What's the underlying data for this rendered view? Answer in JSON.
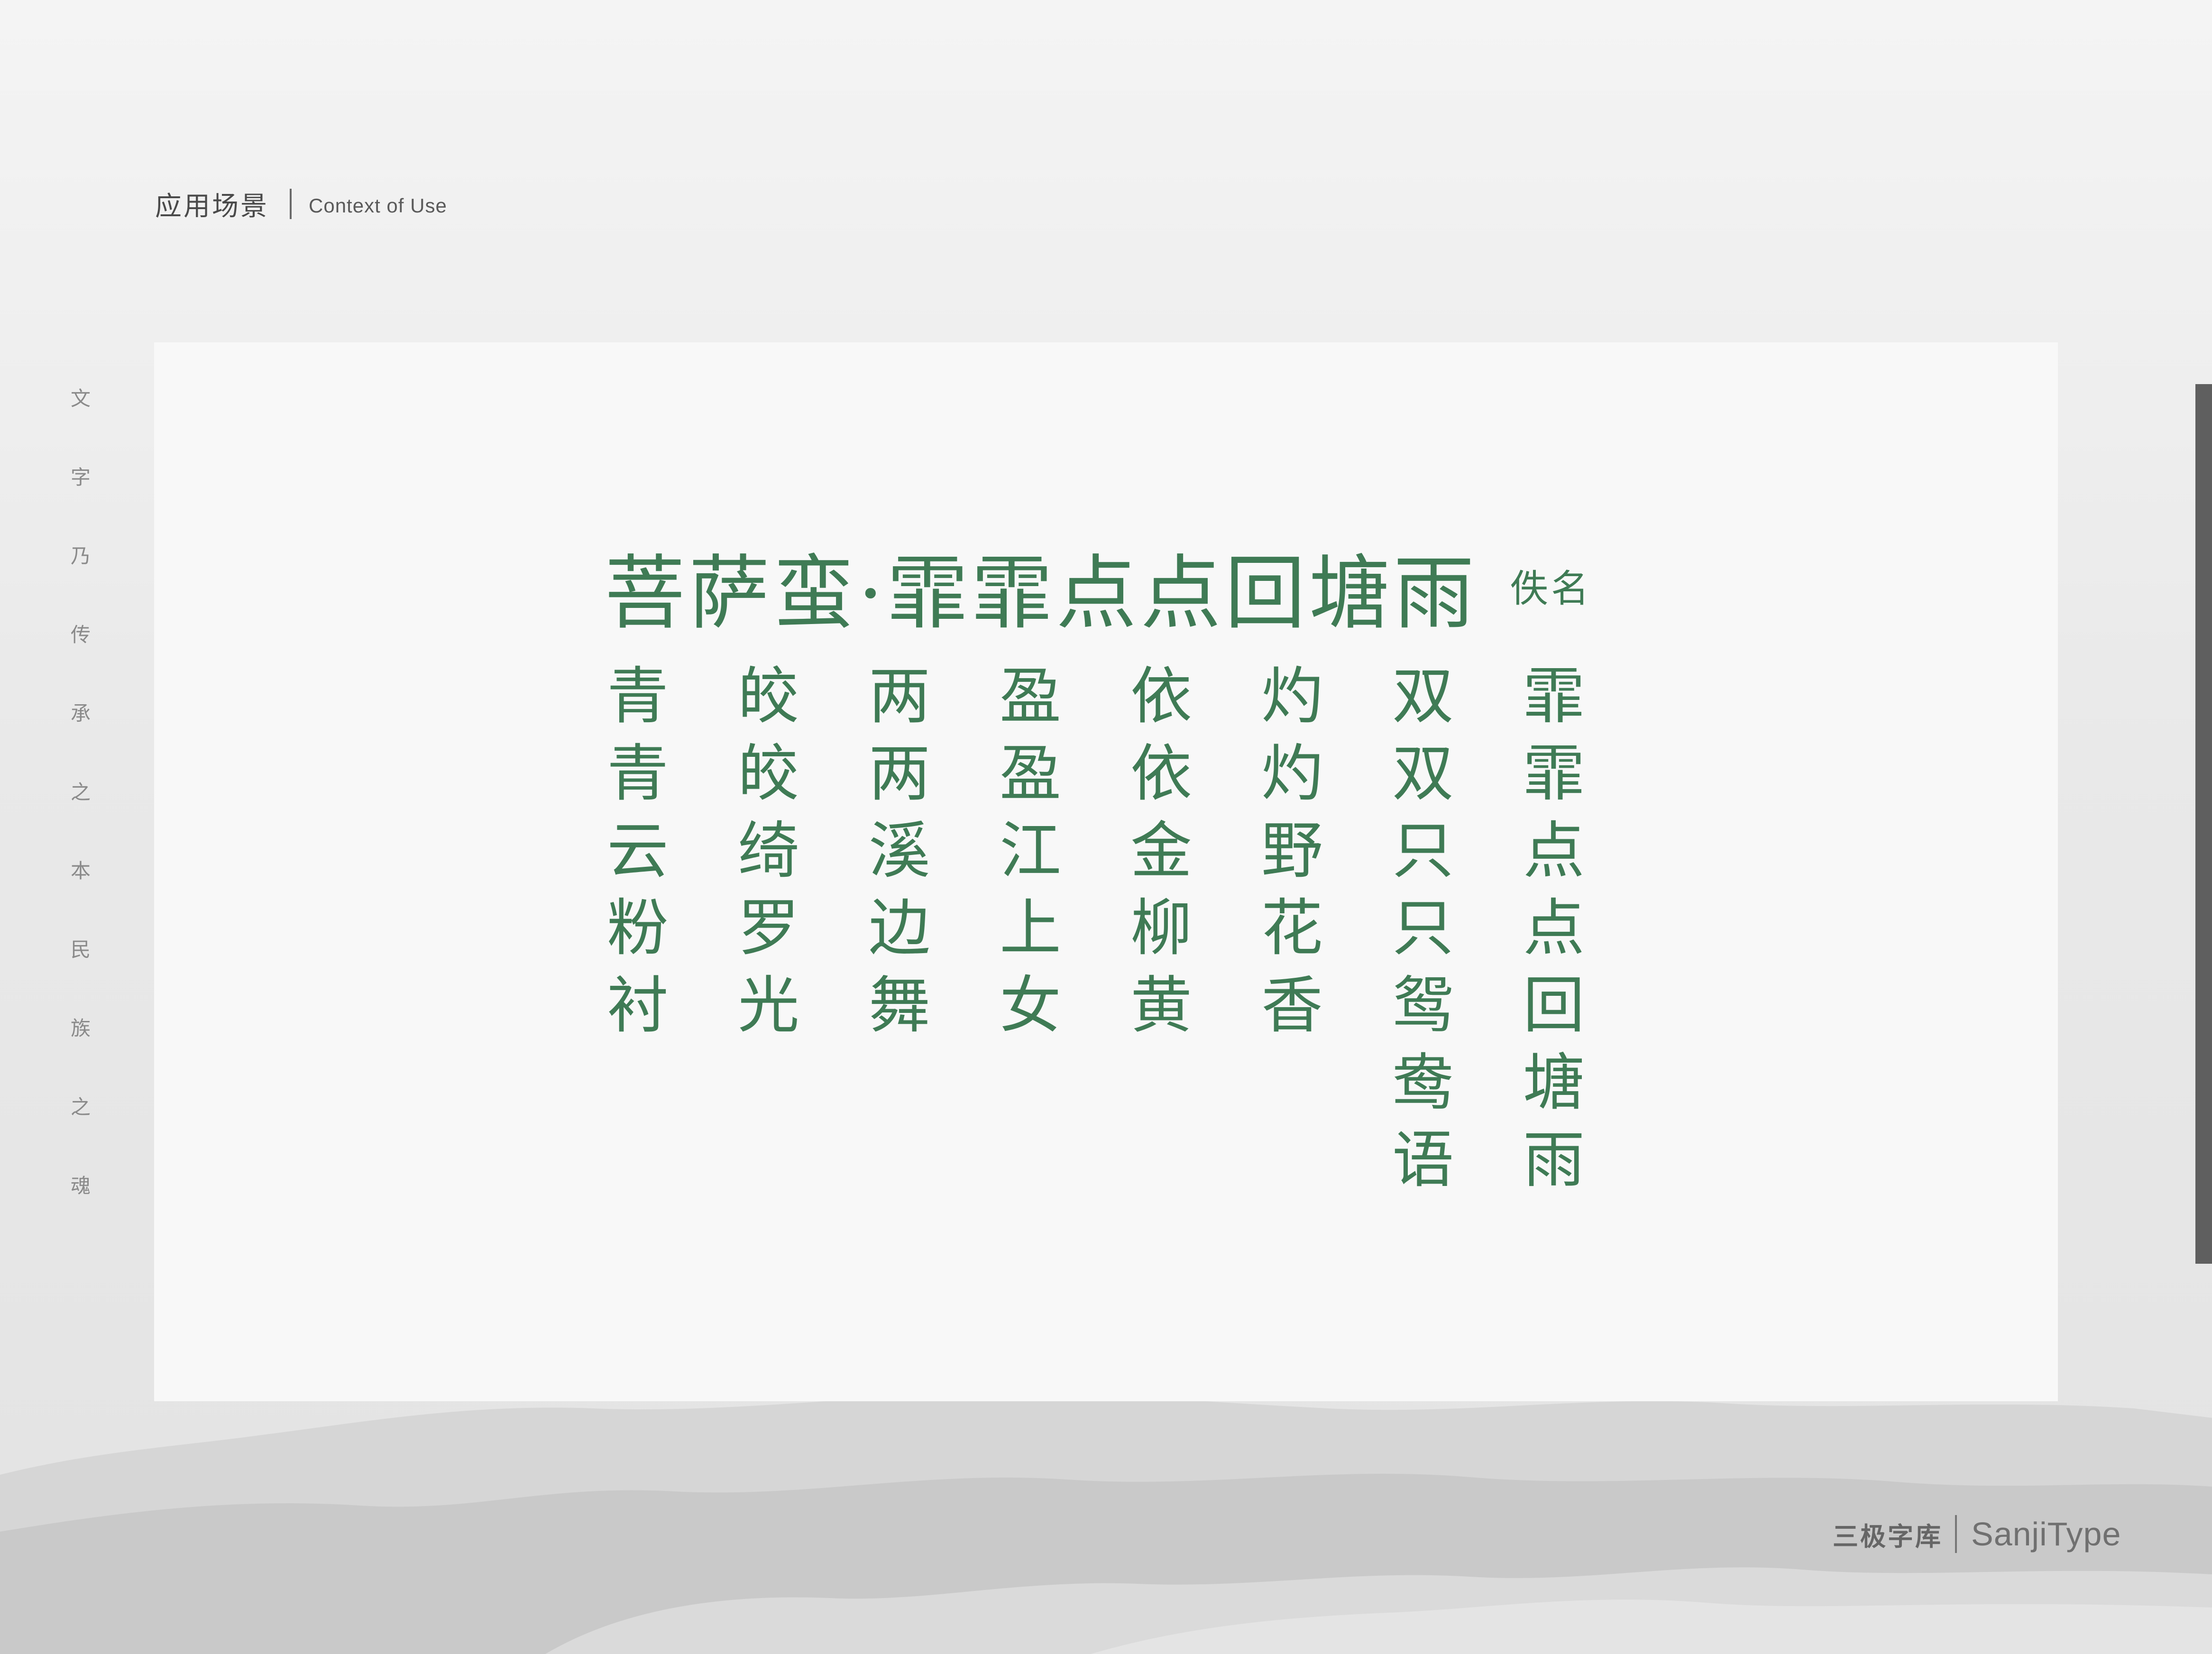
{
  "header": {
    "title_cn": "应用场景",
    "title_en": "Context of Use"
  },
  "motto": [
    "文",
    "字",
    "乃",
    "传",
    "承",
    "之",
    "本",
    "民",
    "族",
    "之",
    "魂"
  ],
  "poem": {
    "title": "菩萨蛮·霏霏点点回塘雨",
    "author": "佚名",
    "columns": [
      [
        "青",
        "青",
        "云",
        "粉",
        "衬"
      ],
      [
        "皎",
        "皎",
        "绮",
        "罗",
        "光"
      ],
      [
        "两",
        "两",
        "溪",
        "边",
        "舞"
      ],
      [
        "盈",
        "盈",
        "江",
        "上",
        "女"
      ],
      [
        "依",
        "依",
        "金",
        "柳",
        "黄"
      ],
      [
        "灼",
        "灼",
        "野",
        "花",
        "香"
      ],
      [
        "双",
        "双",
        "只",
        "只",
        "鸳",
        "鸯",
        "语"
      ],
      [
        "霏",
        "霏",
        "点",
        "点",
        "回",
        "塘",
        "雨"
      ]
    ]
  },
  "brand": {
    "name_cn": "三极字库",
    "name_en": "SanjiType"
  },
  "colors": {
    "poem_ink": "#3f7b55",
    "background": "#e9e9e9",
    "card": "#f8f8f8"
  }
}
